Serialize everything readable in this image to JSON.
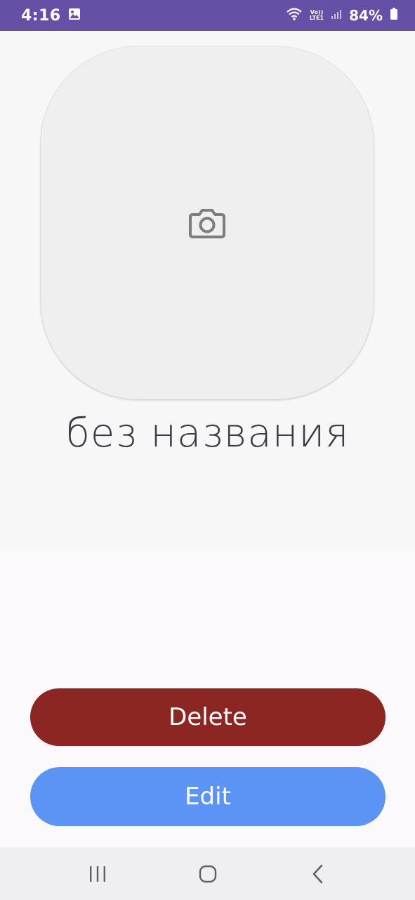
{
  "status_bar": {
    "time": "4:16",
    "network_label_top": "Vo))",
    "network_label_bottom": "LTE1",
    "battery_percent": "84%",
    "background_color": "#6451a5"
  },
  "item": {
    "title": "без названия",
    "photo_placeholder_icon": "camera-icon"
  },
  "actions": {
    "delete_label": "Delete",
    "delete_color": "#8b2623",
    "edit_label": "Edit",
    "edit_color": "#5c94f5"
  },
  "nav_bar": {
    "recents_icon": "recents-icon",
    "home_icon": "home-icon",
    "back_icon": "back-icon"
  }
}
